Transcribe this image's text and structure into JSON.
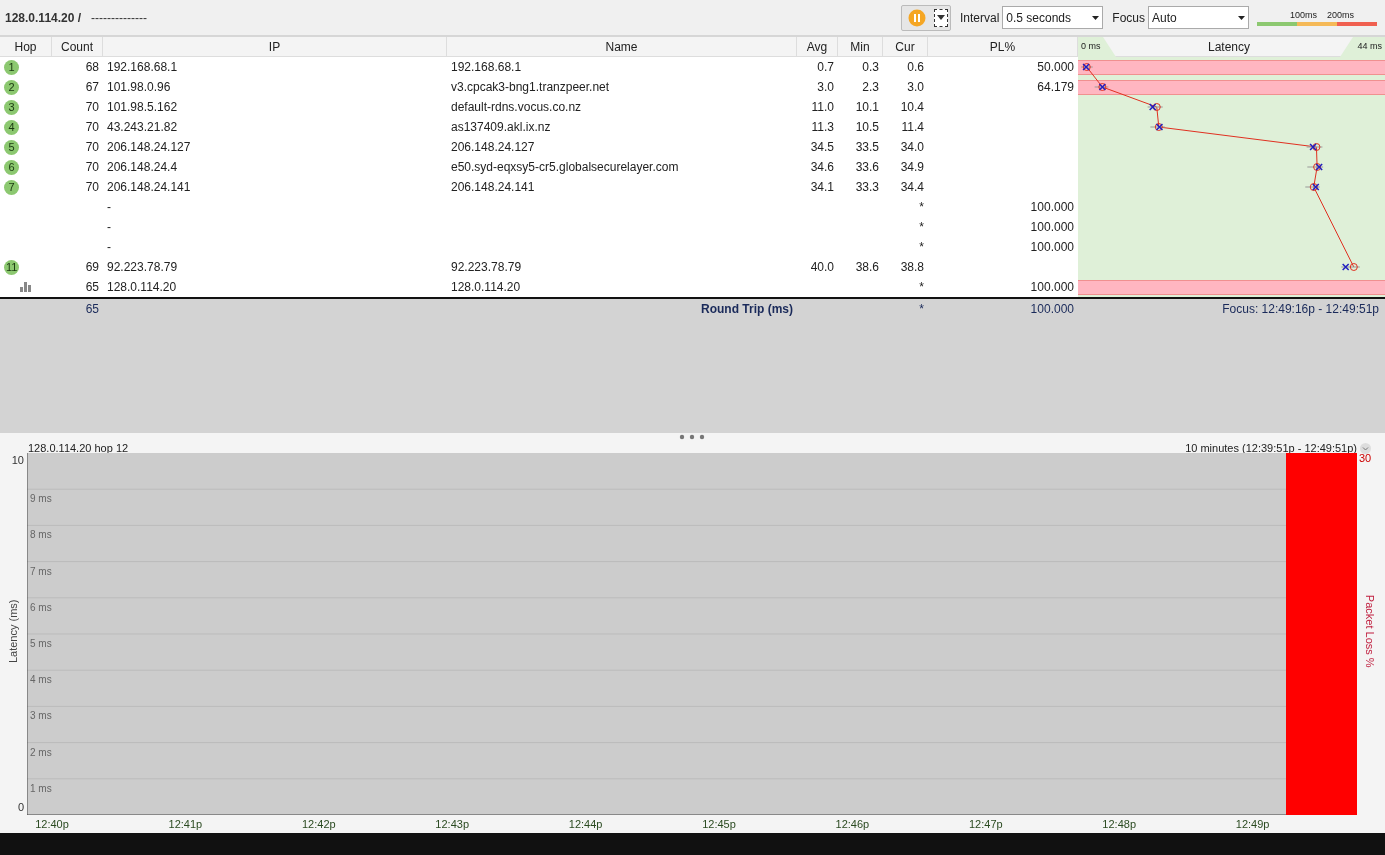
{
  "toolbar": {
    "target": "128.0.114.20 /",
    "subtitle": "--------------",
    "paused": true,
    "interval_label": "Interval",
    "interval": "0.5 seconds",
    "focus_label": "Focus",
    "focus": "Auto",
    "legend": [
      "100ms",
      "200ms"
    ]
  },
  "table": {
    "columns": [
      "Hop",
      "Count",
      "IP",
      "Name",
      "Avg",
      "Min",
      "Cur",
      "PL%",
      "Latency"
    ],
    "latency_min": "0 ms",
    "latency_max": "44 ms",
    "rows": [
      {
        "kind": "hop",
        "hop": "1",
        "count": "68",
        "ip": "192.168.68.1",
        "name": "192.168.68.1",
        "avg": "0.7",
        "min": "0.3",
        "cur": "0.6",
        "pl": "50.000",
        "loss": true
      },
      {
        "kind": "hop",
        "hop": "2",
        "count": "67",
        "ip": "101.98.0.96",
        "name": "v3.cpcak3-bng1.tranzpeer.net",
        "avg": "3.0",
        "min": "2.3",
        "cur": "3.0",
        "pl": "64.179",
        "loss": true
      },
      {
        "kind": "hop",
        "hop": "3",
        "count": "70",
        "ip": "101.98.5.162",
        "name": "default-rdns.vocus.co.nz",
        "avg": "11.0",
        "min": "10.1",
        "cur": "10.4",
        "loss": false
      },
      {
        "kind": "hop",
        "hop": "4",
        "count": "70",
        "ip": "43.243.21.82",
        "name": "as137409.akl.ix.nz",
        "avg": "11.3",
        "min": "10.5",
        "cur": "11.4",
        "loss": false
      },
      {
        "kind": "hop",
        "hop": "5",
        "count": "70",
        "ip": "206.148.24.127",
        "name": "206.148.24.127",
        "avg": "34.5",
        "min": "33.5",
        "cur": "34.0",
        "loss": false
      },
      {
        "kind": "hop",
        "hop": "6",
        "count": "70",
        "ip": "206.148.24.4",
        "name": "e50.syd-eqxsy5-cr5.globalsecurelayer.com",
        "avg": "34.6",
        "min": "33.6",
        "cur": "34.9",
        "loss": false
      },
      {
        "kind": "hop",
        "hop": "7",
        "count": "70",
        "ip": "206.148.24.141",
        "name": "206.148.24.141",
        "avg": "34.1",
        "min": "33.3",
        "cur": "34.4",
        "loss": false
      },
      {
        "kind": "nodata",
        "ip": "-",
        "cur": "*",
        "pl": "100.000",
        "loss": false
      },
      {
        "kind": "nodata",
        "ip": "-",
        "cur": "*",
        "pl": "100.000",
        "loss": false
      },
      {
        "kind": "nodata",
        "ip": "-",
        "cur": "*",
        "pl": "100.000",
        "loss": false
      },
      {
        "kind": "hop",
        "hop": "11",
        "count": "69",
        "ip": "92.223.78.79",
        "name": "92.223.78.79",
        "avg": "40.0",
        "min": "38.6",
        "cur": "38.8",
        "loss": false
      },
      {
        "kind": "target",
        "count": "65",
        "ip": "128.0.114.20",
        "name": "128.0.114.20",
        "cur": "*",
        "pl": "100.000",
        "loss": true
      }
    ],
    "summary": {
      "count": "65",
      "label": "Round Trip (ms)",
      "cur": "*",
      "pl": "100.000",
      "focus": "Focus: 12:49:16p - 12:49:51p"
    }
  },
  "history": {
    "title": "128.0.114.20 hop 12",
    "range": "10 minutes (12:39:51p - 12:49:51p)",
    "right_axis_max": "30",
    "right_axis_label": "Packet Loss %",
    "y_axis_title": "Latency (ms)",
    "y_axis_max": "10",
    "y_axis_min": "0",
    "y_labels": [
      "9 ms",
      "8 ms",
      "7 ms",
      "6 ms",
      "5 ms",
      "4 ms",
      "3 ms",
      "2 ms",
      "1 ms"
    ],
    "x_labels": [
      "12:40p",
      "12:41p",
      "12:42p",
      "12:43p",
      "12:44p",
      "12:45p",
      "12:46p",
      "12:47p",
      "12:48p",
      "12:49p"
    ]
  }
}
